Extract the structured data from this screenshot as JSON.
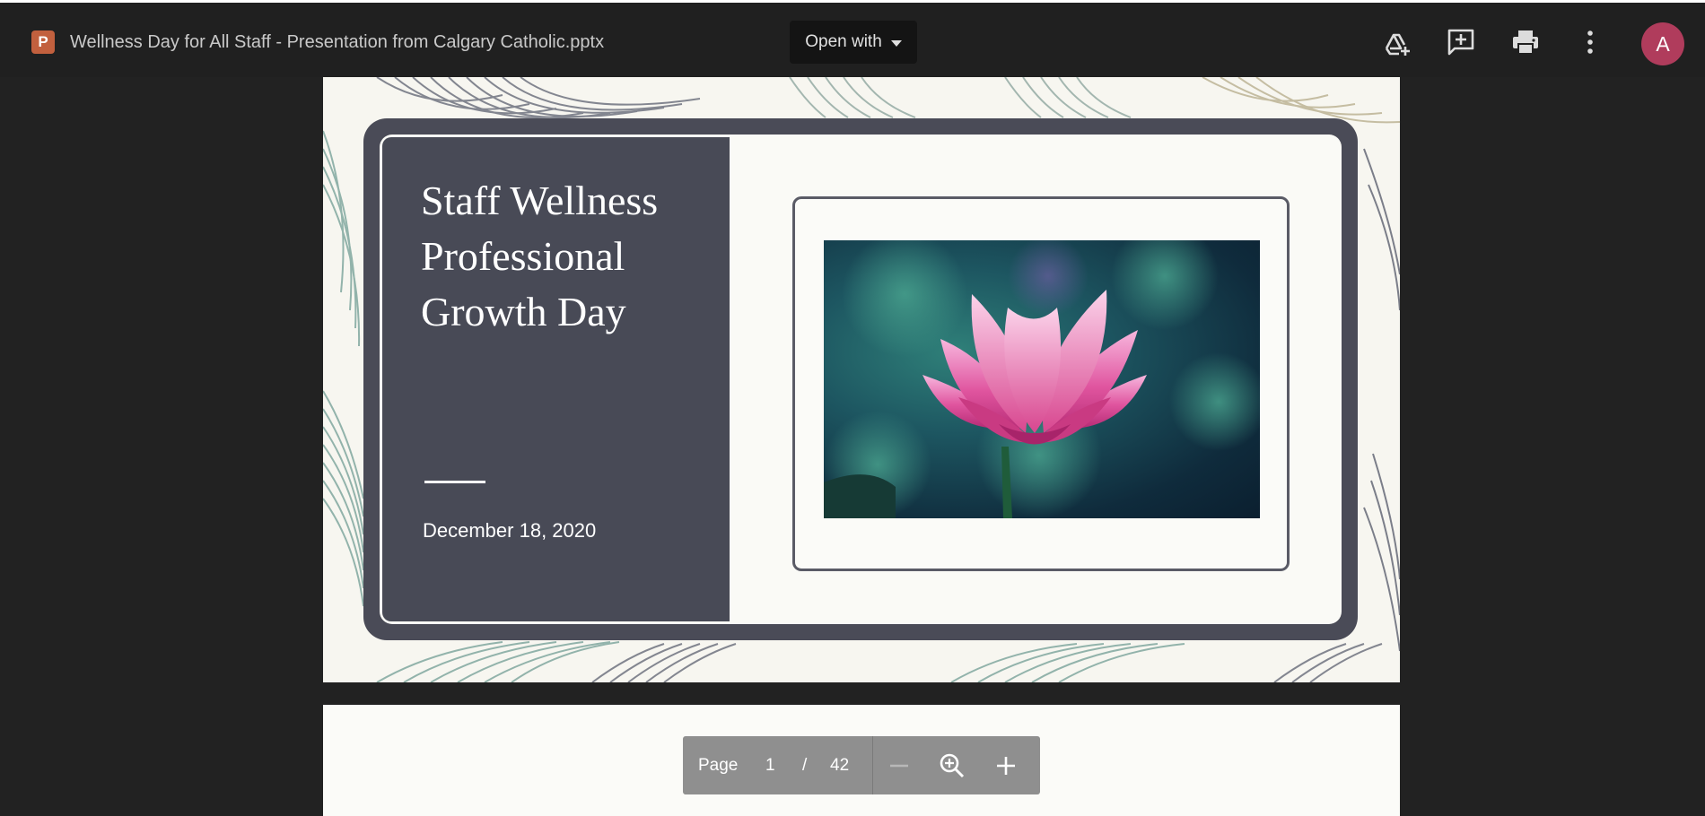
{
  "header": {
    "file_type_letter": "P",
    "file_title": "Wellness Day for All Staff - Presentation from Calgary Catholic.pptx",
    "open_with_label": "Open with",
    "avatar_letter": "A",
    "icons": [
      "add-to-drive-icon",
      "add-comment-icon",
      "print-icon",
      "more-options-icon"
    ]
  },
  "slide": {
    "title_lines": [
      "Staff Wellness",
      "Professional",
      "Growth Day"
    ],
    "date": "December 18, 2020"
  },
  "pager": {
    "page_label": "Page",
    "current_page": "1",
    "separator": "/",
    "total_pages": "42",
    "icons": [
      "zoom-out-icon",
      "zoom-icon",
      "zoom-in-icon"
    ]
  },
  "colors": {
    "accent_avatar": "#b03c5c",
    "file_icon": "#c2603e",
    "slide_panel": "#484a56"
  }
}
